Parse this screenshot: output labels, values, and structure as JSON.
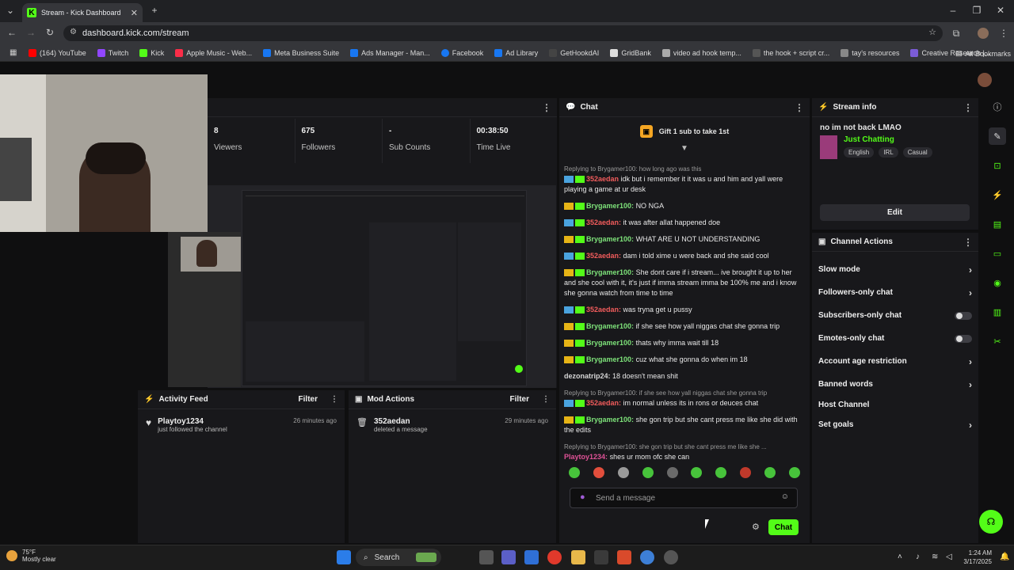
{
  "browser": {
    "tab_title": "Stream - Kick Dashboard",
    "url": "dashboard.kick.com/stream",
    "bookmarks": [
      "(164) YouTube",
      "Twitch",
      "Kick",
      "Apple Music - Web...",
      "Meta Business Suite",
      "Ads Manager - Man...",
      "Facebook",
      "Ad Library",
      "GetHookdAI",
      "GridBank",
      "video ad hook temp...",
      "the hook + script cr...",
      "tay's resources",
      "Creative Research |..."
    ],
    "all_bookmarks": "All Bookmarks"
  },
  "stats": [
    {
      "value": "8",
      "label": "Viewers"
    },
    {
      "value": "675",
      "label": "Followers"
    },
    {
      "value": "-",
      "label": "Sub Counts"
    },
    {
      "value": "00:38:50",
      "label": "Time Live"
    }
  ],
  "chat": {
    "title": "Chat",
    "gift_text": "Gift 1 sub to take 1st",
    "messages": [
      {
        "reply": "Replying to Brygamer100: how long ago was this",
        "user": "352aedan",
        "cls": "un-r",
        "text": "idk but i remember it it was u and him and yall were playing a game at ur desk"
      },
      {
        "reply": "",
        "user": "Brygamer100:",
        "cls": "un-g",
        "text": "NO NGA"
      },
      {
        "reply": "",
        "user": "352aedan:",
        "cls": "un-r",
        "text": "it was after allat happened doe"
      },
      {
        "reply": "",
        "user": "Brygamer100:",
        "cls": "un-g",
        "text": "WHAT ARE U NOT UNDERSTANDING"
      },
      {
        "reply": "",
        "user": "352aedan:",
        "cls": "un-r",
        "text": "dam i told xime u were back and she said cool"
      },
      {
        "reply": "",
        "user": "Brygamer100:",
        "cls": "un-g",
        "text": "She dont care if i stream... ive brought it up to her and she cool with it, it's just if imma stream imma be 100% me and i know she gonna watch from time to time"
      },
      {
        "reply": "",
        "user": "352aedan:",
        "cls": "un-r",
        "text": "was tryna get u pussy"
      },
      {
        "reply": "",
        "user": "Brygamer100:",
        "cls": "un-g",
        "text": "if she see how yall niggas chat she gonna trip"
      },
      {
        "reply": "",
        "user": "Brygamer100:",
        "cls": "un-g",
        "text": "thats why imma wait till 18"
      },
      {
        "reply": "",
        "user": "Brygamer100:",
        "cls": "un-g",
        "text": "cuz what she gonna do when im 18"
      },
      {
        "reply": "",
        "user": "dezonatrip24:",
        "cls": "un-b",
        "text": "18 doesn't mean shit"
      },
      {
        "reply": "Replying to Brygamer100: if she see how yall niggas chat she gonna trip",
        "user": "352aedan:",
        "cls": "un-r",
        "text": "im normal unless its in rons or deuces chat"
      },
      {
        "reply": "",
        "user": "Brygamer100:",
        "cls": "un-g",
        "text": "she gon trip but she cant press me like she did with the edits"
      },
      {
        "reply": "Replying to Brygamer100: she gon trip but she cant press me like she ...",
        "user": "Playtoy1234:",
        "cls": "un-p",
        "text": "shes ur mom ofc she can"
      }
    ],
    "placeholder": "Send a message",
    "send_label": "Chat"
  },
  "stream_info": {
    "title": "Stream info",
    "stream_title": "no im not back LMAO",
    "category": "Just Chatting",
    "tags": [
      "English",
      "IRL",
      "Casual"
    ],
    "edit_label": "Edit"
  },
  "channel_actions": {
    "title": "Channel Actions",
    "items": [
      {
        "label": "Slow mode",
        "kind": "chev"
      },
      {
        "label": "Followers-only chat",
        "kind": "chev"
      },
      {
        "label": "Subscribers-only chat",
        "kind": "toggle"
      },
      {
        "label": "Emotes-only chat",
        "kind": "toggle"
      },
      {
        "label": "Account age restriction",
        "kind": "chev"
      },
      {
        "label": "Banned words",
        "kind": "chev"
      },
      {
        "label": "Host Channel",
        "kind": "none"
      },
      {
        "label": "Set goals",
        "kind": "chev"
      }
    ]
  },
  "activity_feed": {
    "title": "Activity Feed",
    "filter": "Filter",
    "item": {
      "user": "Playtoy1234",
      "action": "just followed the channel",
      "time": "26 minutes ago"
    }
  },
  "mod_actions": {
    "title": "Mod Actions",
    "filter": "Filter",
    "item": {
      "user": "352aedan",
      "action": "deleted a message",
      "time": "29 minutes ago"
    }
  },
  "taskbar": {
    "weather_temp": "75°F",
    "weather_desc": "Mostly clear",
    "search": "Search",
    "time": "1:24 AM",
    "date": "3/17/2025"
  },
  "colors": {
    "accent": "#53fc18",
    "panel": "#18181b"
  }
}
